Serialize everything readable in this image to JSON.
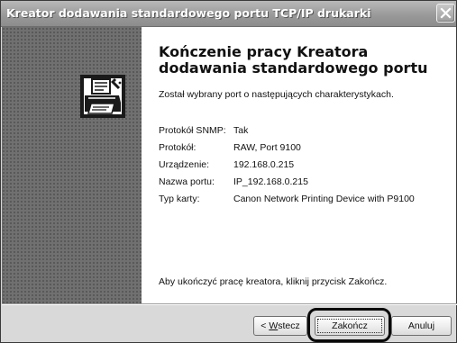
{
  "window": {
    "title": "Kreator dodawania standardowego portu TCP/IP drukarki"
  },
  "content": {
    "heading_line1": "Kończenie pracy Kreatora",
    "heading_line2": "dodawania standardowego portu",
    "intro": "Został wybrany port o następujących charakterystykach.",
    "details": [
      {
        "label": "Protokół SNMP:",
        "value": "Tak"
      },
      {
        "label": "Protokół:",
        "value": "RAW, Port 9100"
      },
      {
        "label": "Urządzenie:",
        "value": "192.168.0.215"
      },
      {
        "label": "Nazwa portu:",
        "value": "IP_192.168.0.215"
      },
      {
        "label": "Typ karty:",
        "value": "Canon Network Printing Device with P9100"
      }
    ],
    "outro": "Aby ukończyć pracę kreatora, kliknij przycisk Zakończ."
  },
  "buttons": {
    "back_prefix": "< ",
    "back_accel": "W",
    "back_rest": "stecz",
    "finish": "Zakończ",
    "cancel": "Anuluj"
  },
  "icons": {
    "wizard": "printer-wizard-icon",
    "close": "close-icon"
  }
}
